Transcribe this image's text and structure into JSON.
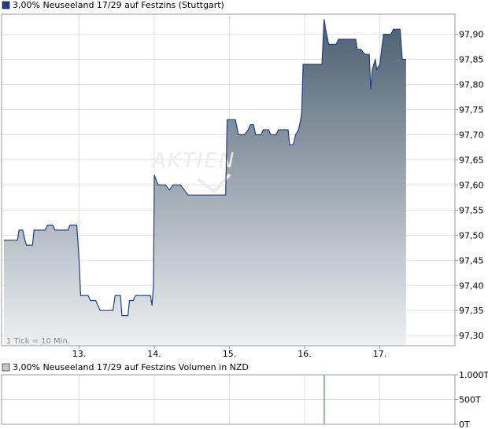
{
  "legend": {
    "price_label": "3,00% Neuseeland 17/29 auf Festzins (Stuttgart)",
    "price_swatch_color": "#1e3f8a",
    "volume_label": "3,00% Neuseeland 17/29 auf Festzins Volumen in NZD",
    "volume_swatch_color": "#c8c8c8"
  },
  "note": "1 Tick = 10 Min.",
  "watermark": "AKTIEN",
  "chart_data": [
    {
      "type": "area",
      "title": "3,00% Neuseeland 17/29 auf Festzins (Stuttgart)",
      "x_ticks": [
        "13.",
        "14.",
        "15.",
        "16.",
        "17."
      ],
      "y_ticks": [
        "97,90",
        "97,85",
        "97,80",
        "97,75",
        "97,70",
        "97,65",
        "97,60",
        "97,55",
        "97,50",
        "97,45",
        "97,40",
        "97,35",
        "97,30"
      ],
      "ylim": [
        97.28,
        97.94
      ],
      "xlim": [
        0,
        5.95
      ],
      "grid": true,
      "line_color": "#1e3f8a",
      "fill_top_color": "#4a5f70",
      "fill_bottom_color": "#eef0f2",
      "points": [
        [
          0.0,
          97.49
        ],
        [
          0.18,
          97.49
        ],
        [
          0.2,
          97.51
        ],
        [
          0.25,
          97.51
        ],
        [
          0.28,
          97.49
        ],
        [
          0.3,
          97.48
        ],
        [
          0.38,
          97.48
        ],
        [
          0.4,
          97.51
        ],
        [
          0.55,
          97.51
        ],
        [
          0.58,
          97.52
        ],
        [
          0.65,
          97.52
        ],
        [
          0.68,
          97.51
        ],
        [
          0.85,
          97.51
        ],
        [
          0.88,
          97.52
        ],
        [
          0.97,
          97.52
        ],
        [
          1.0,
          97.45
        ],
        [
          1.02,
          97.38
        ],
        [
          1.12,
          97.38
        ],
        [
          1.15,
          97.37
        ],
        [
          1.22,
          97.37
        ],
        [
          1.25,
          97.36
        ],
        [
          1.28,
          97.35
        ],
        [
          1.45,
          97.35
        ],
        [
          1.48,
          97.38
        ],
        [
          1.55,
          97.38
        ],
        [
          1.57,
          97.34
        ],
        [
          1.65,
          97.34
        ],
        [
          1.67,
          97.37
        ],
        [
          1.72,
          97.37
        ],
        [
          1.75,
          97.38
        ],
        [
          1.95,
          97.38
        ],
        [
          1.97,
          97.36
        ],
        [
          1.99,
          97.4
        ],
        [
          2.0,
          97.62
        ],
        [
          2.05,
          97.6
        ],
        [
          2.15,
          97.6
        ],
        [
          2.2,
          97.59
        ],
        [
          2.25,
          97.6
        ],
        [
          2.35,
          97.6
        ],
        [
          2.4,
          97.59
        ],
        [
          2.45,
          97.58
        ],
        [
          2.95,
          97.58
        ],
        [
          2.97,
          97.73
        ],
        [
          3.08,
          97.73
        ],
        [
          3.12,
          97.7
        ],
        [
          3.2,
          97.7
        ],
        [
          3.25,
          97.71
        ],
        [
          3.28,
          97.72
        ],
        [
          3.32,
          97.72
        ],
        [
          3.35,
          97.7
        ],
        [
          3.42,
          97.7
        ],
        [
          3.45,
          97.71
        ],
        [
          3.52,
          97.71
        ],
        [
          3.55,
          97.7
        ],
        [
          3.62,
          97.7
        ],
        [
          3.65,
          97.71
        ],
        [
          3.78,
          97.71
        ],
        [
          3.8,
          97.68
        ],
        [
          3.85,
          97.68
        ],
        [
          3.88,
          97.7
        ],
        [
          3.92,
          97.71
        ],
        [
          3.96,
          97.74
        ],
        [
          3.98,
          97.84
        ],
        [
          4.23,
          97.84
        ],
        [
          4.26,
          97.93
        ],
        [
          4.28,
          97.91
        ],
        [
          4.32,
          97.88
        ],
        [
          4.42,
          97.88
        ],
        [
          4.45,
          97.89
        ],
        [
          4.68,
          97.89
        ],
        [
          4.7,
          97.87
        ],
        [
          4.75,
          97.87
        ],
        [
          4.8,
          97.86
        ],
        [
          4.86,
          97.86
        ],
        [
          4.88,
          97.79
        ],
        [
          4.9,
          97.83
        ],
        [
          4.94,
          97.85
        ],
        [
          4.96,
          97.83
        ],
        [
          5.0,
          97.84
        ],
        [
          5.05,
          97.9
        ],
        [
          5.15,
          97.9
        ],
        [
          5.18,
          97.91
        ],
        [
          5.27,
          97.91
        ],
        [
          5.3,
          97.85
        ],
        [
          5.35,
          97.85
        ]
      ]
    },
    {
      "type": "bar",
      "title": "3,00% Neuseeland 17/29 auf Festzins Volumen in NZD",
      "y_ticks": [
        "1.000T",
        "500T",
        "0T"
      ],
      "ylim": [
        0,
        1000
      ],
      "bar_color": "#3aa63a",
      "bars": [
        {
          "x": 4.26,
          "value": 1000
        }
      ]
    }
  ]
}
